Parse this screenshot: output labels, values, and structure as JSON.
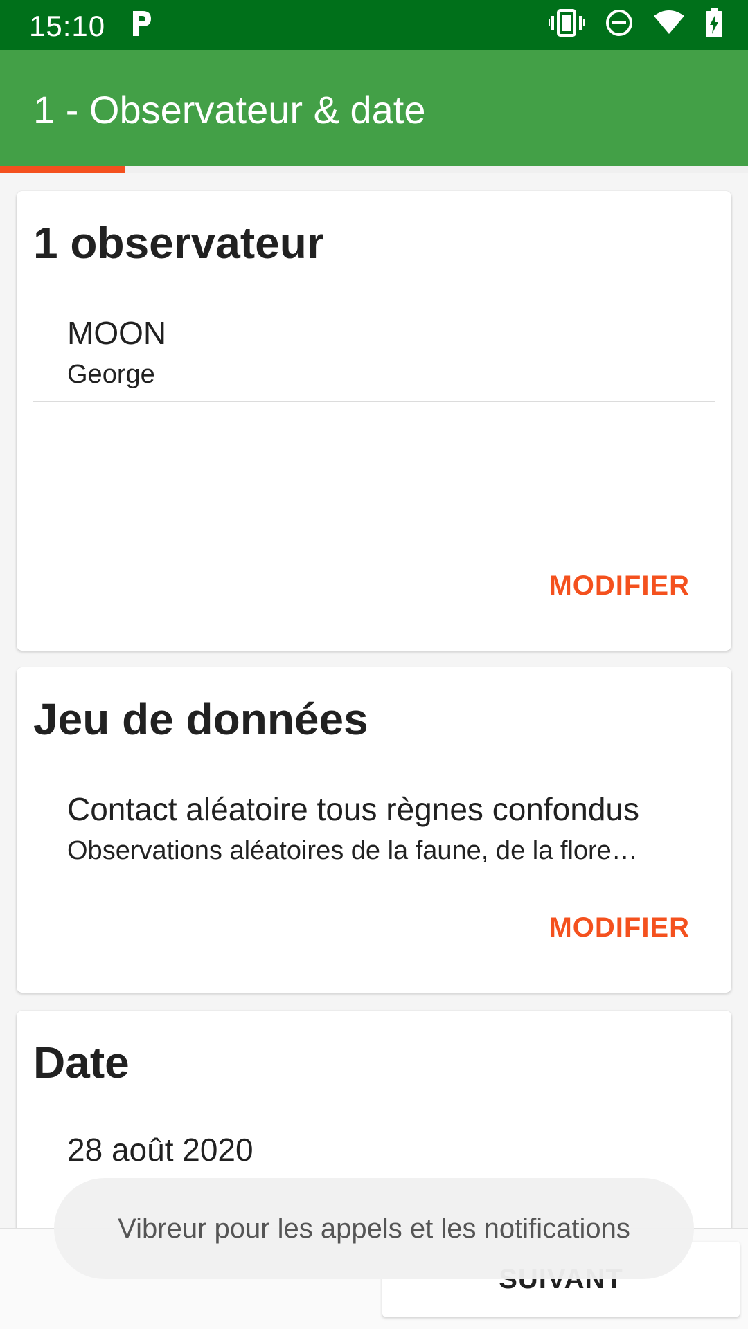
{
  "status_bar": {
    "time": "15:10",
    "notification_icon": "p-icon",
    "icons": [
      "vibrate-icon",
      "do-not-disturb-icon",
      "wifi-icon",
      "battery-charging-icon"
    ]
  },
  "app_bar": {
    "title": "1 - Observateur & date"
  },
  "progress": {
    "fraction": 0.167
  },
  "observers_card": {
    "title": "1 observateur",
    "observer": {
      "last_name": "MOON",
      "first_name": "George"
    },
    "action_label": "MODIFIER"
  },
  "dataset_card": {
    "title": "Jeu de données",
    "dataset_name": "Contact aléatoire tous règnes confondus",
    "dataset_description": "Observations aléatoires de la faune, de la flore…",
    "action_label": "MODIFIER"
  },
  "date_card": {
    "title": "Date",
    "date_value": "28 août 2020"
  },
  "bottom": {
    "next_label": "SUIVANT"
  },
  "toast": {
    "message": "Vibreur pour les appels et les notifications"
  },
  "colors": {
    "status_bar": "#00701a",
    "app_bar": "#43a047",
    "accent": "#f4511e"
  }
}
